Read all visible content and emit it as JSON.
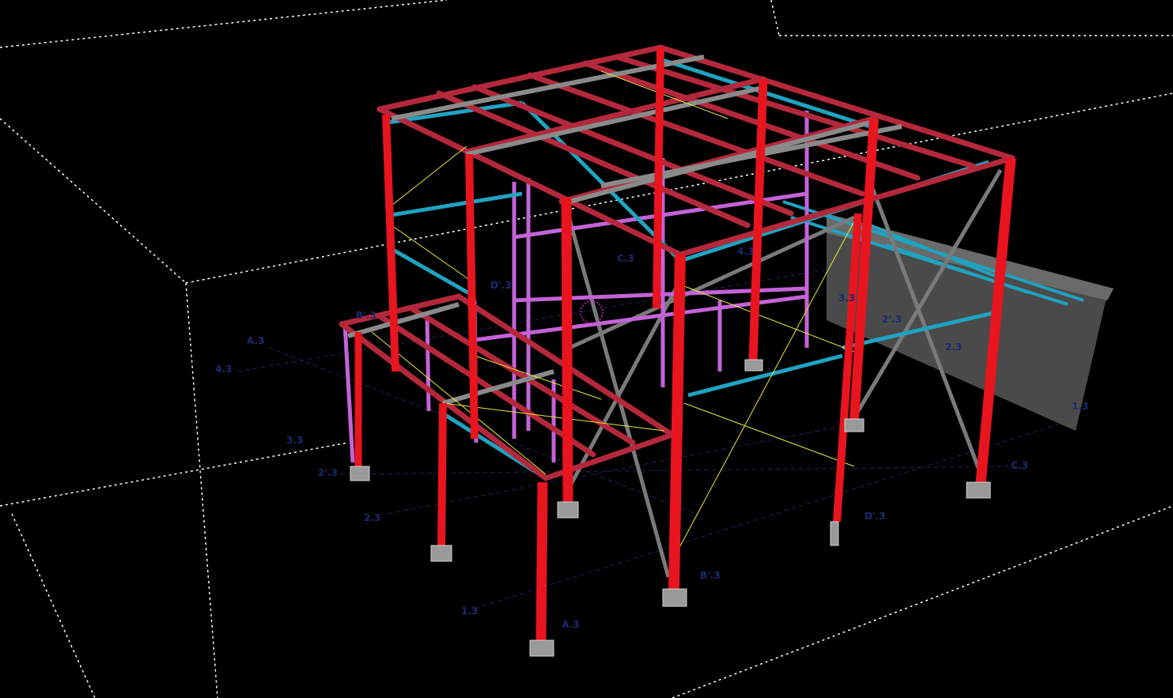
{
  "colors": {
    "background": "#000000",
    "column": "#e8141e",
    "beam": "#b4283c",
    "secondary_beam": "#7a7a7a",
    "tie_beam": "#1fa3c0",
    "interior_frame": "#c463d8",
    "bracing": "#eaea3a",
    "grid_line": "#ffffff",
    "label": "#1c2a6e",
    "wall": "#4a4a4a"
  },
  "grid_labels": {
    "a3_left": "A.3",
    "g43_left": "4.3",
    "g3_left": "3.3",
    "g23b_left": "2'.3",
    "g23_left": "2.3",
    "g13_left": "1.3",
    "a3_bottom": "A.3",
    "b3_left": "B'.3",
    "c3_mid": "C.3",
    "d3_mid": "D'.3",
    "g43_top": "4.3",
    "g33_right": "3.3",
    "g23b_right": "2'.3",
    "g23_right": "2.3",
    "g13_right": "1.3",
    "c3_right": "C.3",
    "d3_right": "D'.3",
    "b3_bottom": "B'.3"
  },
  "icons": {
    "cursor": "cursor-target-icon"
  }
}
